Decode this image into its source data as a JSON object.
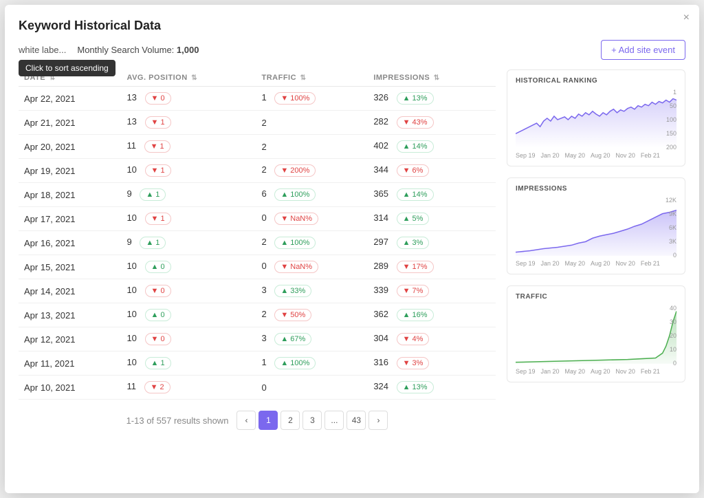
{
  "modal": {
    "title": "Keyword Historical Data",
    "close_label": "×"
  },
  "header": {
    "keyword_label": "white labe...",
    "tooltip": "Click to sort ascending",
    "monthly_label": "Monthly Search Volume:",
    "monthly_value": "1,000",
    "add_event_label": "+ Add site event"
  },
  "table": {
    "columns": [
      "DATE",
      "AVG. Position",
      "TRAFFIC",
      "IMPRESSIONS"
    ],
    "rows": [
      {
        "date": "Apr 22, 2021",
        "position": 13,
        "pos_badge": "0",
        "pos_dir": "down",
        "traffic": 1,
        "traffic_badge": "100%",
        "traffic_dir": "down",
        "impressions": 326,
        "imp_badge": "13%",
        "imp_dir": "up"
      },
      {
        "date": "Apr 21, 2021",
        "position": 13,
        "pos_badge": "1",
        "pos_dir": "down",
        "traffic": 2,
        "traffic_badge": null,
        "traffic_dir": null,
        "impressions": 282,
        "imp_badge": "43%",
        "imp_dir": "down"
      },
      {
        "date": "Apr 20, 2021",
        "position": 11,
        "pos_badge": "1",
        "pos_dir": "down",
        "traffic": 2,
        "traffic_badge": null,
        "traffic_dir": null,
        "impressions": 402,
        "imp_badge": "14%",
        "imp_dir": "up"
      },
      {
        "date": "Apr 19, 2021",
        "position": 10,
        "pos_badge": "1",
        "pos_dir": "down",
        "traffic": 2,
        "traffic_badge": "200%",
        "traffic_dir": "down",
        "impressions": 344,
        "imp_badge": "6%",
        "imp_dir": "down"
      },
      {
        "date": "Apr 18, 2021",
        "position": 9,
        "pos_badge": "1",
        "pos_dir": "up",
        "traffic": 6,
        "traffic_badge": "100%",
        "traffic_dir": "up",
        "impressions": 365,
        "imp_badge": "14%",
        "imp_dir": "up"
      },
      {
        "date": "Apr 17, 2021",
        "position": 10,
        "pos_badge": "1",
        "pos_dir": "down",
        "traffic": 0,
        "traffic_badge": "NaN%",
        "traffic_dir": "down",
        "impressions": 314,
        "imp_badge": "5%",
        "imp_dir": "up"
      },
      {
        "date": "Apr 16, 2021",
        "position": 9,
        "pos_badge": "1",
        "pos_dir": "up",
        "traffic": 2,
        "traffic_badge": "100%",
        "traffic_dir": "up",
        "impressions": 297,
        "imp_badge": "3%",
        "imp_dir": "up"
      },
      {
        "date": "Apr 15, 2021",
        "position": 10,
        "pos_badge": "0",
        "pos_dir": "up",
        "traffic": 0,
        "traffic_badge": "NaN%",
        "traffic_dir": "down",
        "impressions": 289,
        "imp_badge": "17%",
        "imp_dir": "down"
      },
      {
        "date": "Apr 14, 2021",
        "position": 10,
        "pos_badge": "0",
        "pos_dir": "down",
        "traffic": 3,
        "traffic_badge": "33%",
        "traffic_dir": "up",
        "impressions": 339,
        "imp_badge": "7%",
        "imp_dir": "down"
      },
      {
        "date": "Apr 13, 2021",
        "position": 10,
        "pos_badge": "0",
        "pos_dir": "up",
        "traffic": 2,
        "traffic_badge": "50%",
        "traffic_dir": "down",
        "impressions": 362,
        "imp_badge": "16%",
        "imp_dir": "up"
      },
      {
        "date": "Apr 12, 2021",
        "position": 10,
        "pos_badge": "0",
        "pos_dir": "down",
        "traffic": 3,
        "traffic_badge": "67%",
        "traffic_dir": "up",
        "impressions": 304,
        "imp_badge": "4%",
        "imp_dir": "down"
      },
      {
        "date": "Apr 11, 2021",
        "position": 10,
        "pos_badge": "1",
        "pos_dir": "up",
        "traffic": 1,
        "traffic_badge": "100%",
        "traffic_dir": "up",
        "impressions": 316,
        "imp_badge": "3%",
        "imp_dir": "down"
      },
      {
        "date": "Apr 10, 2021",
        "position": 11,
        "pos_badge": "2",
        "pos_dir": "down",
        "traffic": 0,
        "traffic_badge": null,
        "traffic_dir": null,
        "impressions": 324,
        "imp_badge": "13%",
        "imp_dir": "up"
      }
    ]
  },
  "pagination": {
    "info": "1-13 of 557 results shown",
    "pages": [
      "‹",
      "1",
      "2",
      "3",
      "...",
      "43",
      "›"
    ],
    "active": "1"
  },
  "charts": {
    "ranking": {
      "title": "HISTORICAL RANKING",
      "x_labels": [
        "Sep 19",
        "Jan 20",
        "May 20",
        "Aug 20",
        "Nov 20",
        "Feb 21"
      ],
      "y_labels": [
        "1",
        "50",
        "100",
        "150",
        "200"
      ]
    },
    "impressions": {
      "title": "IMPRESSIONS",
      "x_labels": [
        "Sep 19",
        "Jan 20",
        "May 20",
        "Aug 20",
        "Nov 20",
        "Feb 21"
      ],
      "y_labels": [
        "12K",
        "9K",
        "6K",
        "3K",
        "0"
      ]
    },
    "traffic": {
      "title": "TRAFFIC",
      "x_labels": [
        "Sep 19",
        "Jan 20",
        "May 20",
        "Aug 20",
        "Nov 20",
        "Feb 21"
      ],
      "y_labels": [
        "40",
        "30",
        "20",
        "10",
        "0"
      ]
    }
  }
}
